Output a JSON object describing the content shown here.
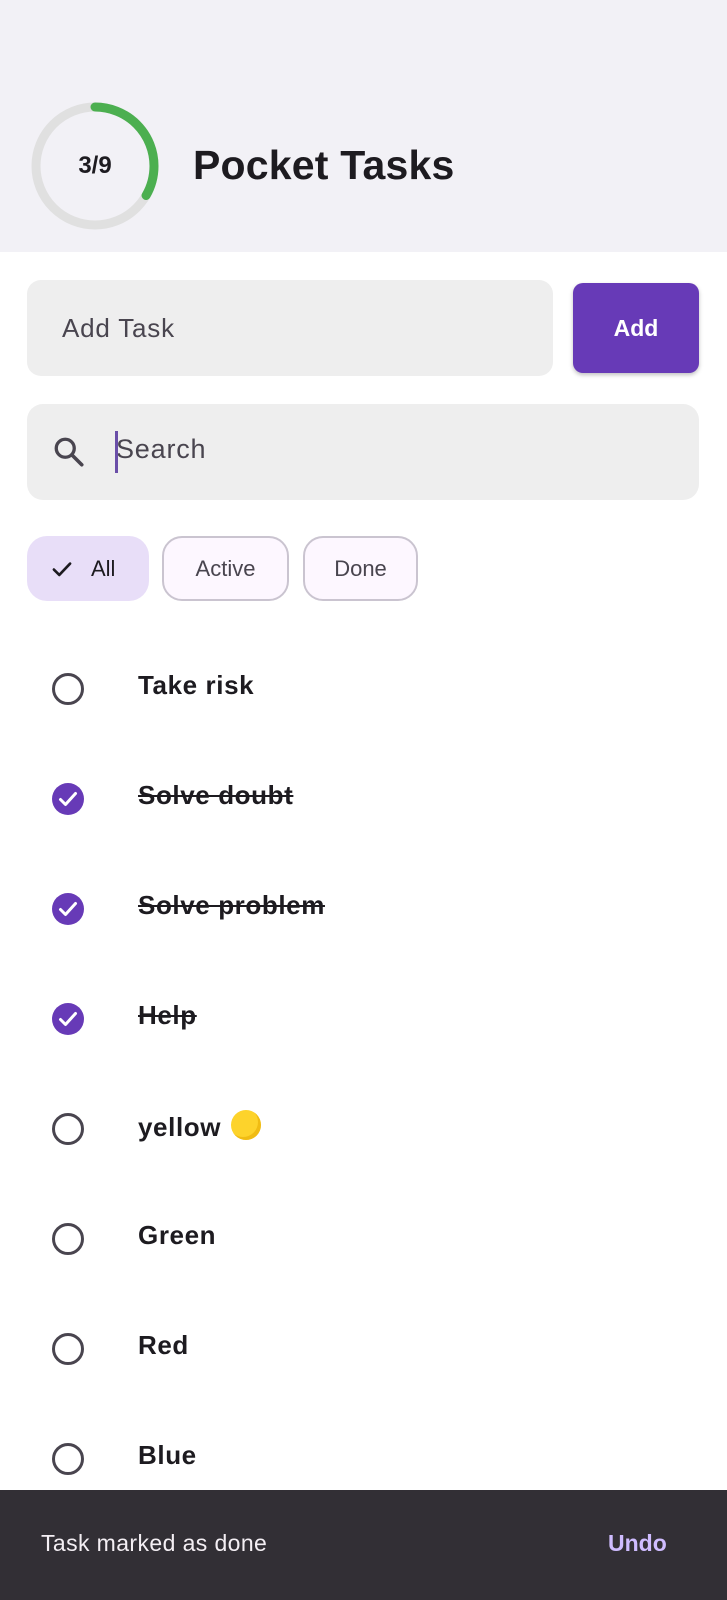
{
  "header": {
    "progress_text": "3/9",
    "progress_fraction": 0.3333,
    "title": "Pocket Tasks"
  },
  "add_task": {
    "placeholder": "Add Task",
    "button_label": "Add"
  },
  "search": {
    "placeholder": "Search",
    "icon": "search-icon"
  },
  "filters": [
    {
      "label": "All",
      "selected": true
    },
    {
      "label": "Active",
      "selected": false
    },
    {
      "label": "Done",
      "selected": false
    }
  ],
  "tasks": [
    {
      "label": "Take risk",
      "done": false
    },
    {
      "label": "Solve doubt",
      "done": true
    },
    {
      "label": "Solve problem",
      "done": true
    },
    {
      "label": "Help",
      "done": true
    },
    {
      "label": "yellow",
      "done": false,
      "emoji": "yellow-circle"
    },
    {
      "label": "Green",
      "done": false
    },
    {
      "label": "Red",
      "done": false
    },
    {
      "label": "Blue",
      "done": false
    }
  ],
  "snackbar": {
    "message": "Task marked as done",
    "action": "Undo"
  },
  "colors": {
    "primary": "#673ab7",
    "progress": "#4caf50",
    "track": "#e0e0e0",
    "chip_selected": "#e8def8",
    "snackbar_bg": "#322f35",
    "snackbar_action": "#cfbcff"
  }
}
